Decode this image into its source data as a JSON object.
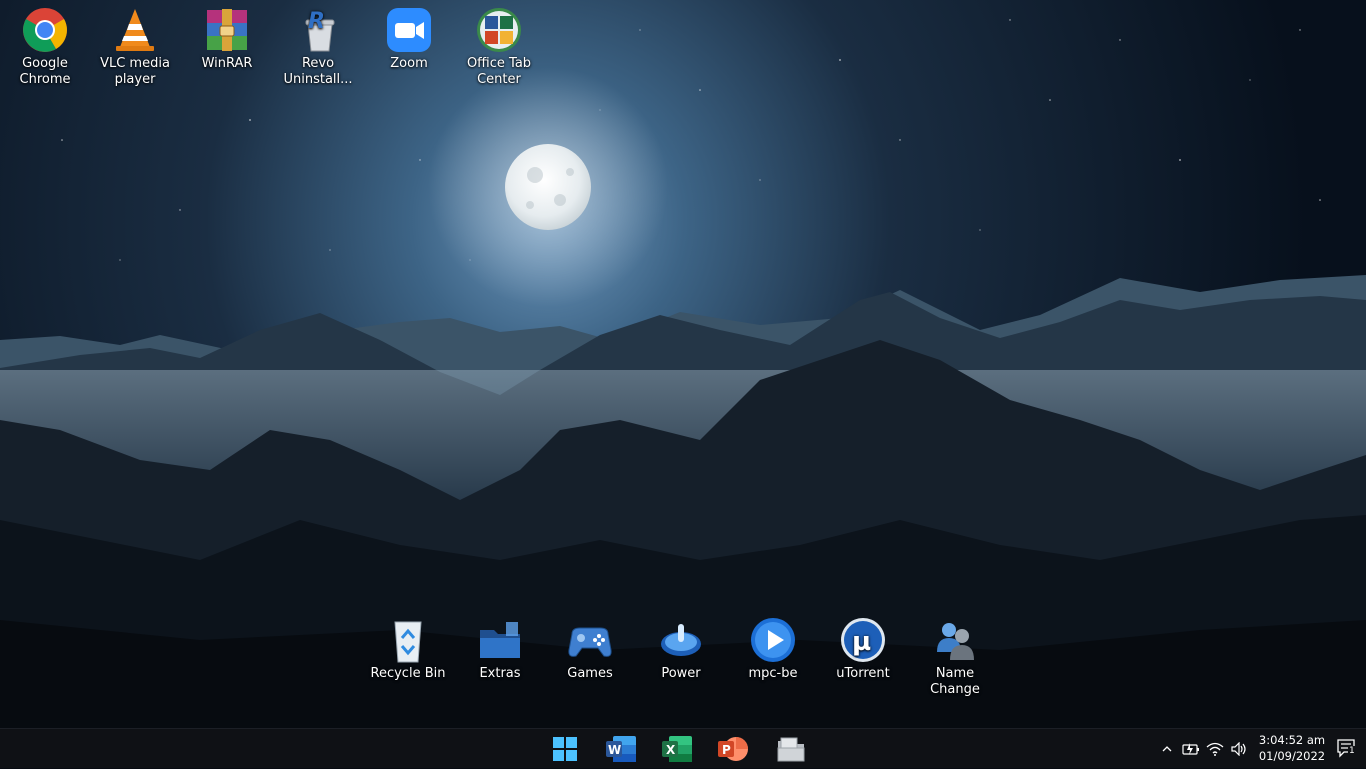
{
  "desktop": {
    "top_icons": [
      {
        "label": "Google Chrome",
        "icon": "chrome-icon"
      },
      {
        "label": "VLC media player",
        "icon": "vlc-icon"
      },
      {
        "label": "WinRAR",
        "icon": "winrar-icon"
      },
      {
        "label": "Revo Uninstall...",
        "icon": "revo-uninstaller-icon"
      },
      {
        "label": "Zoom",
        "icon": "zoom-icon"
      },
      {
        "label": "Office Tab Center",
        "icon": "office-tab-center-icon"
      }
    ],
    "dock_icons": [
      {
        "label": "Recycle Bin",
        "icon": "recycle-bin-icon"
      },
      {
        "label": "Extras",
        "icon": "folder-icon"
      },
      {
        "label": "Games",
        "icon": "gamepad-icon"
      },
      {
        "label": "Power",
        "icon": "power-icon"
      },
      {
        "label": "mpc-be",
        "icon": "play-icon"
      },
      {
        "label": "uTorrent",
        "icon": "utorrent-icon"
      },
      {
        "label": "Name Change",
        "icon": "users-icon"
      }
    ]
  },
  "taskbar": {
    "pinned": [
      "windows-start-icon",
      "word-icon",
      "excel-icon",
      "powerpoint-icon",
      "file-explorer-icon"
    ],
    "tray": {
      "chevron": "chevron-up-icon",
      "icons": [
        "battery-charging-icon",
        "wifi-icon",
        "volume-icon"
      ]
    },
    "clock": {
      "time": "3:04:52 am",
      "date": "01/09/2022"
    },
    "notifications": {
      "icon": "notification-icon",
      "count": "1"
    }
  },
  "colors": {
    "sky_top": "#07101c",
    "sky_glow": "#4f7ea6",
    "moon": "#eef2f4",
    "taskbar": "#0f1115",
    "word": "#2b579a",
    "excel": "#1e7145",
    "powerpoint": "#d24726"
  }
}
